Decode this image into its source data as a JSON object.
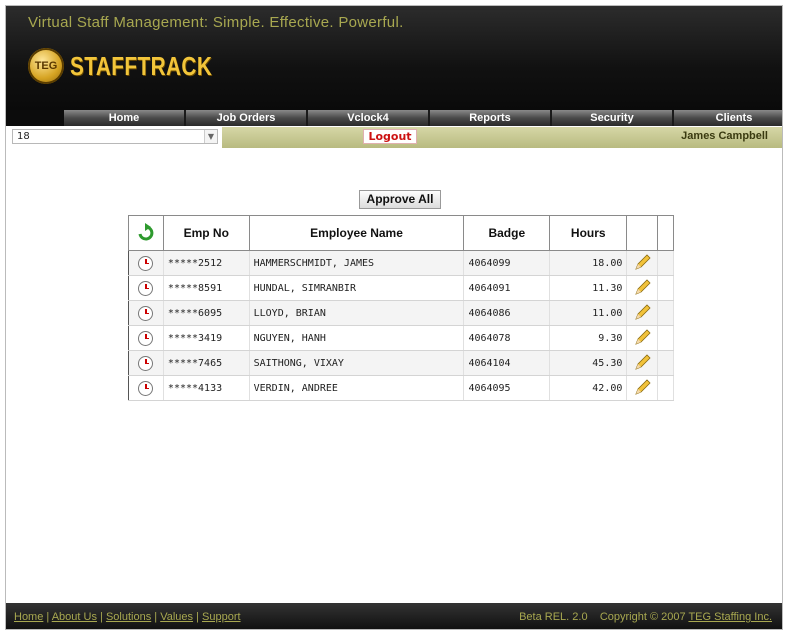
{
  "header": {
    "tagline": "Virtual Staff Management: Simple. Effective. Powerful.",
    "logo_badge": "TEG",
    "logo_text": "STAFFTRACK"
  },
  "nav": {
    "items": [
      {
        "label": "Home"
      },
      {
        "label": "Job Orders"
      },
      {
        "label": "Vclock4"
      },
      {
        "label": "Reports"
      },
      {
        "label": "Security"
      },
      {
        "label": "Clients"
      }
    ]
  },
  "toolbar": {
    "select_value": "18",
    "logout_label": "Logout",
    "user_name": "James Campbell"
  },
  "actions": {
    "approve_all_label": "Approve All"
  },
  "table": {
    "columns": [
      "Emp No",
      "Employee Name",
      "Badge",
      "Hours"
    ],
    "rows": [
      {
        "emp_no": "*****2512",
        "name": "HAMMERSCHMIDT, JAMES",
        "badge": "4064099",
        "hours": "18.00"
      },
      {
        "emp_no": "*****8591",
        "name": "HUNDAL, SIMRANBIR",
        "badge": "4064091",
        "hours": "11.30"
      },
      {
        "emp_no": "*****6095",
        "name": "LLOYD, BRIAN",
        "badge": "4064086",
        "hours": "11.00"
      },
      {
        "emp_no": "*****3419",
        "name": "NGUYEN, HANH",
        "badge": "4064078",
        "hours": "9.30"
      },
      {
        "emp_no": "*****7465",
        "name": "SAITHONG, VIXAY",
        "badge": "4064104",
        "hours": "45.30"
      },
      {
        "emp_no": "*****4133",
        "name": "VERDIN, ANDREE",
        "badge": "4064095",
        "hours": "42.00"
      }
    ]
  },
  "footer": {
    "links": [
      "Home",
      "About Us",
      "Solutions",
      "Values",
      "Support"
    ],
    "version": "Beta REL. 2.0",
    "copyright": "Copyright © 2007",
    "company": "TEG Staffing Inc."
  },
  "icons": {
    "refresh": "refresh-icon",
    "clock": "clock-icon",
    "edit": "pencil-icon",
    "dropdown": "chevron-down-icon"
  }
}
